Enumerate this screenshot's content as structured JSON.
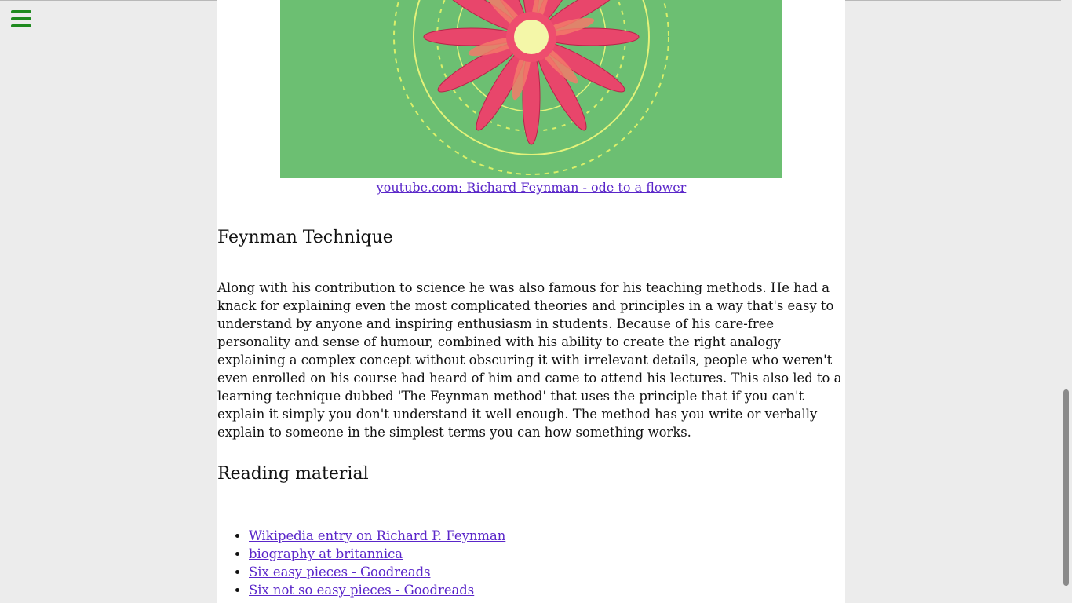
{
  "video": {
    "caption": "youtube.com: Richard Feynman - ode to a flower"
  },
  "section_technique": {
    "title": "Feynman Technique",
    "paragraph": "Along with his contribution to science he was also famous for his teaching methods. He had a knack for explaining even the most complicated theories and principles in a way that's easy to understand by anyone and inspiring enthusiasm in students. Because of his care-free personality and sense of humour, combined with his ability to create the right analogy explaining a complex concept without obscuring it with irrelevant details, people who weren't even enrolled on his course had heard of him and came to attend his lectures. This also led to a learning technique dubbed 'The Feynman method' that uses the principle that if you can't explain it simply you don't understand it well enough. The method has you write or verbally explain to someone in the simplest terms you can how something works."
  },
  "section_reading": {
    "title": "Reading material",
    "links": [
      "Wikipedia entry on Richard P. Feynman",
      "biography at britannica",
      "Six easy pieces - Goodreads",
      "Six not so easy pieces - Goodreads"
    ]
  },
  "colors": {
    "menu_icon": "#1f8a1f",
    "link": "#5a26c9",
    "hero_background": "#6cbf72",
    "page_background": "#ececec"
  }
}
